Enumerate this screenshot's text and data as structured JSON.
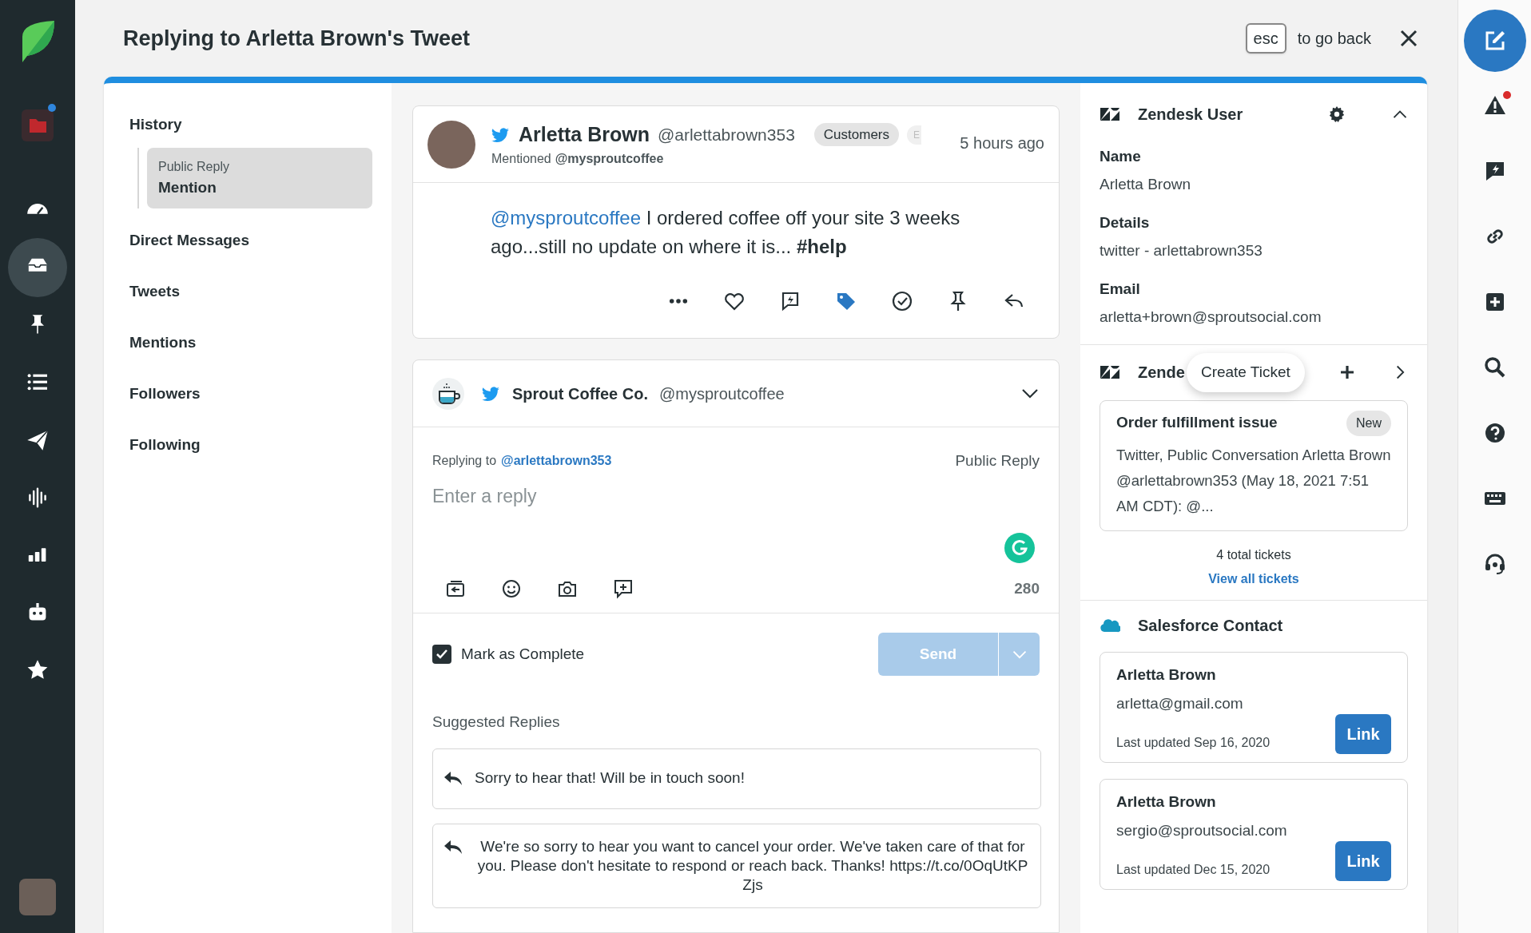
{
  "sidebar": {
    "items": [
      {
        "selected": false,
        "notification": true
      },
      {
        "selected": false,
        "notification": false
      },
      {
        "selected": true,
        "notification": false
      },
      {
        "selected": false,
        "notification": false
      },
      {
        "selected": false,
        "notification": false
      },
      {
        "selected": false,
        "notification": false
      },
      {
        "selected": false,
        "notification": false
      },
      {
        "selected": false,
        "notification": false
      },
      {
        "selected": false,
        "notification": false
      },
      {
        "selected": false,
        "notification": false
      }
    ]
  },
  "header": {
    "title": "Replying to Arletta Brown's Tweet",
    "key_hint": "esc",
    "hint": "to go back"
  },
  "history": {
    "title": "History",
    "entries": [
      {
        "label": "Public Reply",
        "title": "Mention",
        "selected": true
      }
    ],
    "items": [
      "Direct Messages",
      "Tweets",
      "Mentions",
      "Followers",
      "Following"
    ]
  },
  "tweet": {
    "author": "Arletta Brown",
    "handle": "@arlettabrown353",
    "tags": [
      "Customers",
      "E"
    ],
    "time": "5 hours ago",
    "context": "Mentioned",
    "context_handle": "@mysproutcoffee",
    "mention": "@mysproutcoffee",
    "text": " I ordered coffee off your site 3 weeks ago...still no update on where it is... **#help**",
    "actions": [
      {
        "selected": false
      },
      {
        "selected": false
      },
      {
        "selected": false
      },
      {
        "selected": true
      },
      {
        "selected": false
      },
      {
        "selected": false
      },
      {
        "selected": false
      }
    ]
  },
  "reply": {
    "account": "Sprout Coffee Co.",
    "handle": "@mysproutcoffee",
    "replying_to_label": "Replying to",
    "replying_to": "@arlettabrown353",
    "reply_type": "Public Reply",
    "placeholder": "Enter a reply",
    "char_count": "280",
    "mark_complete": {
      "label": "Mark as Complete",
      "checked": true
    },
    "send": {
      "label": "Send",
      "disabled": true
    },
    "suggested_title": "Suggested Replies",
    "suggestions": [
      "Sorry to hear that! Will be in touch soon!",
      "We're so sorry to hear you want to cancel your order. We've taken care of that for you. Please don't hesitate to respond or reach back. Thanks! https://t.co/0OqUtKPZjs"
    ]
  },
  "zendesk_user": {
    "title": "Zendesk User",
    "expanded": true,
    "fields": [
      {
        "label": "Name",
        "value": "Arletta Brown"
      },
      {
        "label": "Details",
        "value": "twitter - arlettabrown353"
      },
      {
        "label": "Email",
        "value": "arletta+brown@sproutsocial.com"
      }
    ]
  },
  "zendesk_tickets": {
    "title": "Zende",
    "tooltip": "Create Ticket",
    "ticket": {
      "title": "Order fulfillment issue",
      "status": "New",
      "summary": "Twitter, Public Conversation Arletta Brown @arlettabrown353 (May 18, 2021 7:51 AM CDT): @..."
    },
    "total": "4 total tickets",
    "view_all": "View all tickets"
  },
  "salesforce": {
    "title": "Salesforce Contact",
    "contacts": [
      {
        "name": "Arletta Brown",
        "email": "arletta@gmail.com",
        "updated": "Last updated Sep 16, 2020",
        "action": "Link"
      },
      {
        "name": "Arletta Brown",
        "email": "sergio@sproutsocial.com",
        "updated": "Last updated Dec 15, 2020",
        "action": "Link"
      }
    ]
  },
  "rail": {
    "items": [
      {
        "notification": true
      },
      {
        "notification": false
      },
      {
        "notification": false
      },
      {
        "notification": false
      },
      {
        "notification": false
      },
      {
        "notification": false
      },
      {
        "notification": false
      },
      {
        "notification": false
      }
    ]
  }
}
